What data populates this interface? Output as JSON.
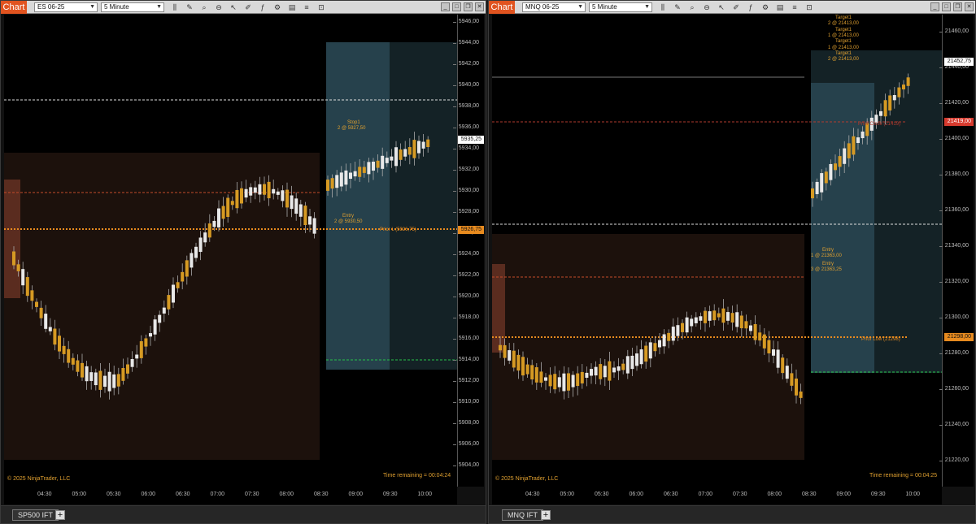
{
  "windows": [
    {
      "chart_button": "Chart",
      "instrument": "ES 06-25",
      "interval": "5 Minute",
      "copyright": "© 2025 NinjaTrader, LLC",
      "time_remaining": "Time remaining = 00:04:24",
      "tab": "SP500 IFT",
      "add_tab": "+",
      "price_ticks": [
        "5946,00",
        "5944,00",
        "5942,00",
        "5940,00",
        "5938,00",
        "5936,00",
        "5934,00",
        "5932,00",
        "5930,00",
        "5928,00",
        "5926,00",
        "5924,00",
        "5922,00",
        "5920,00",
        "5918,00",
        "5916,00",
        "5914,00",
        "5912,00",
        "5910,00",
        "5908,00",
        "5906,00",
        "5904,00"
      ],
      "time_ticks": [
        "04:30",
        "05:00",
        "05:30",
        "06:00",
        "06:30",
        "07:00",
        "07:30",
        "08:00",
        "08:30",
        "09:00",
        "09:30",
        "10:00"
      ],
      "price_tags": [
        {
          "text": "5935,25",
          "style": "white"
        },
        {
          "text": "5926,75",
          "style": "orange"
        }
      ],
      "annotations": {
        "stop_title": "Stop1",
        "stop_detail": "2 @ 5927,50",
        "entry_title": "Entry",
        "entry_detail": "2 @ 5930,50",
        "prior_level": "Prior L (5926,75)"
      }
    },
    {
      "chart_button": "Chart",
      "instrument": "MNQ 06-25",
      "interval": "5 Minute",
      "copyright": "© 2025 NinjaTrader, LLC",
      "time_remaining": "Time remaining = 00:04:25",
      "tab": "MNQ IFT",
      "add_tab": "+",
      "price_ticks": [
        "21460,00",
        "21440,00",
        "21420,00",
        "21400,00",
        "21380,00",
        "21360,00",
        "21340,00",
        "21320,00",
        "21300,00",
        "21280,00",
        "21260,00",
        "21240,00",
        "21220,00"
      ],
      "time_ticks": [
        "04:30",
        "05:00",
        "05:30",
        "06:00",
        "06:30",
        "07:00",
        "07:30",
        "08:00",
        "08:30",
        "09:00",
        "09:30",
        "10:00"
      ],
      "price_tags": [
        {
          "text": "21452,75",
          "style": "white"
        },
        {
          "text": "21419,00",
          "style": "red"
        },
        {
          "text": "21298,00",
          "style": "orange"
        }
      ],
      "annotations": {
        "targets": [
          "Target1",
          "2 @ 21413,00",
          "Target1",
          "1 @ 21413,00",
          "Target1",
          "1 @ 21413,00",
          "Target1",
          "2 @ 21413,00"
        ],
        "entry_a_title": "Entry",
        "entry_a_detail": "1 @ 21363,00",
        "entry_b_title": "Entry",
        "entry_b_detail": "3 @ 21363,25",
        "prior_close": "Prior Close (21419)",
        "prior_low": "Prior Low (21298)"
      }
    }
  ],
  "colors": {
    "accent": "#e0531f",
    "bull_candle": "#d69a23",
    "bear_candle": "#e8e8e8",
    "prior_low": "#e88b1f",
    "prior_close": "#b03a2e",
    "green_level": "#27c24a",
    "annotation": "#e0a030"
  }
}
